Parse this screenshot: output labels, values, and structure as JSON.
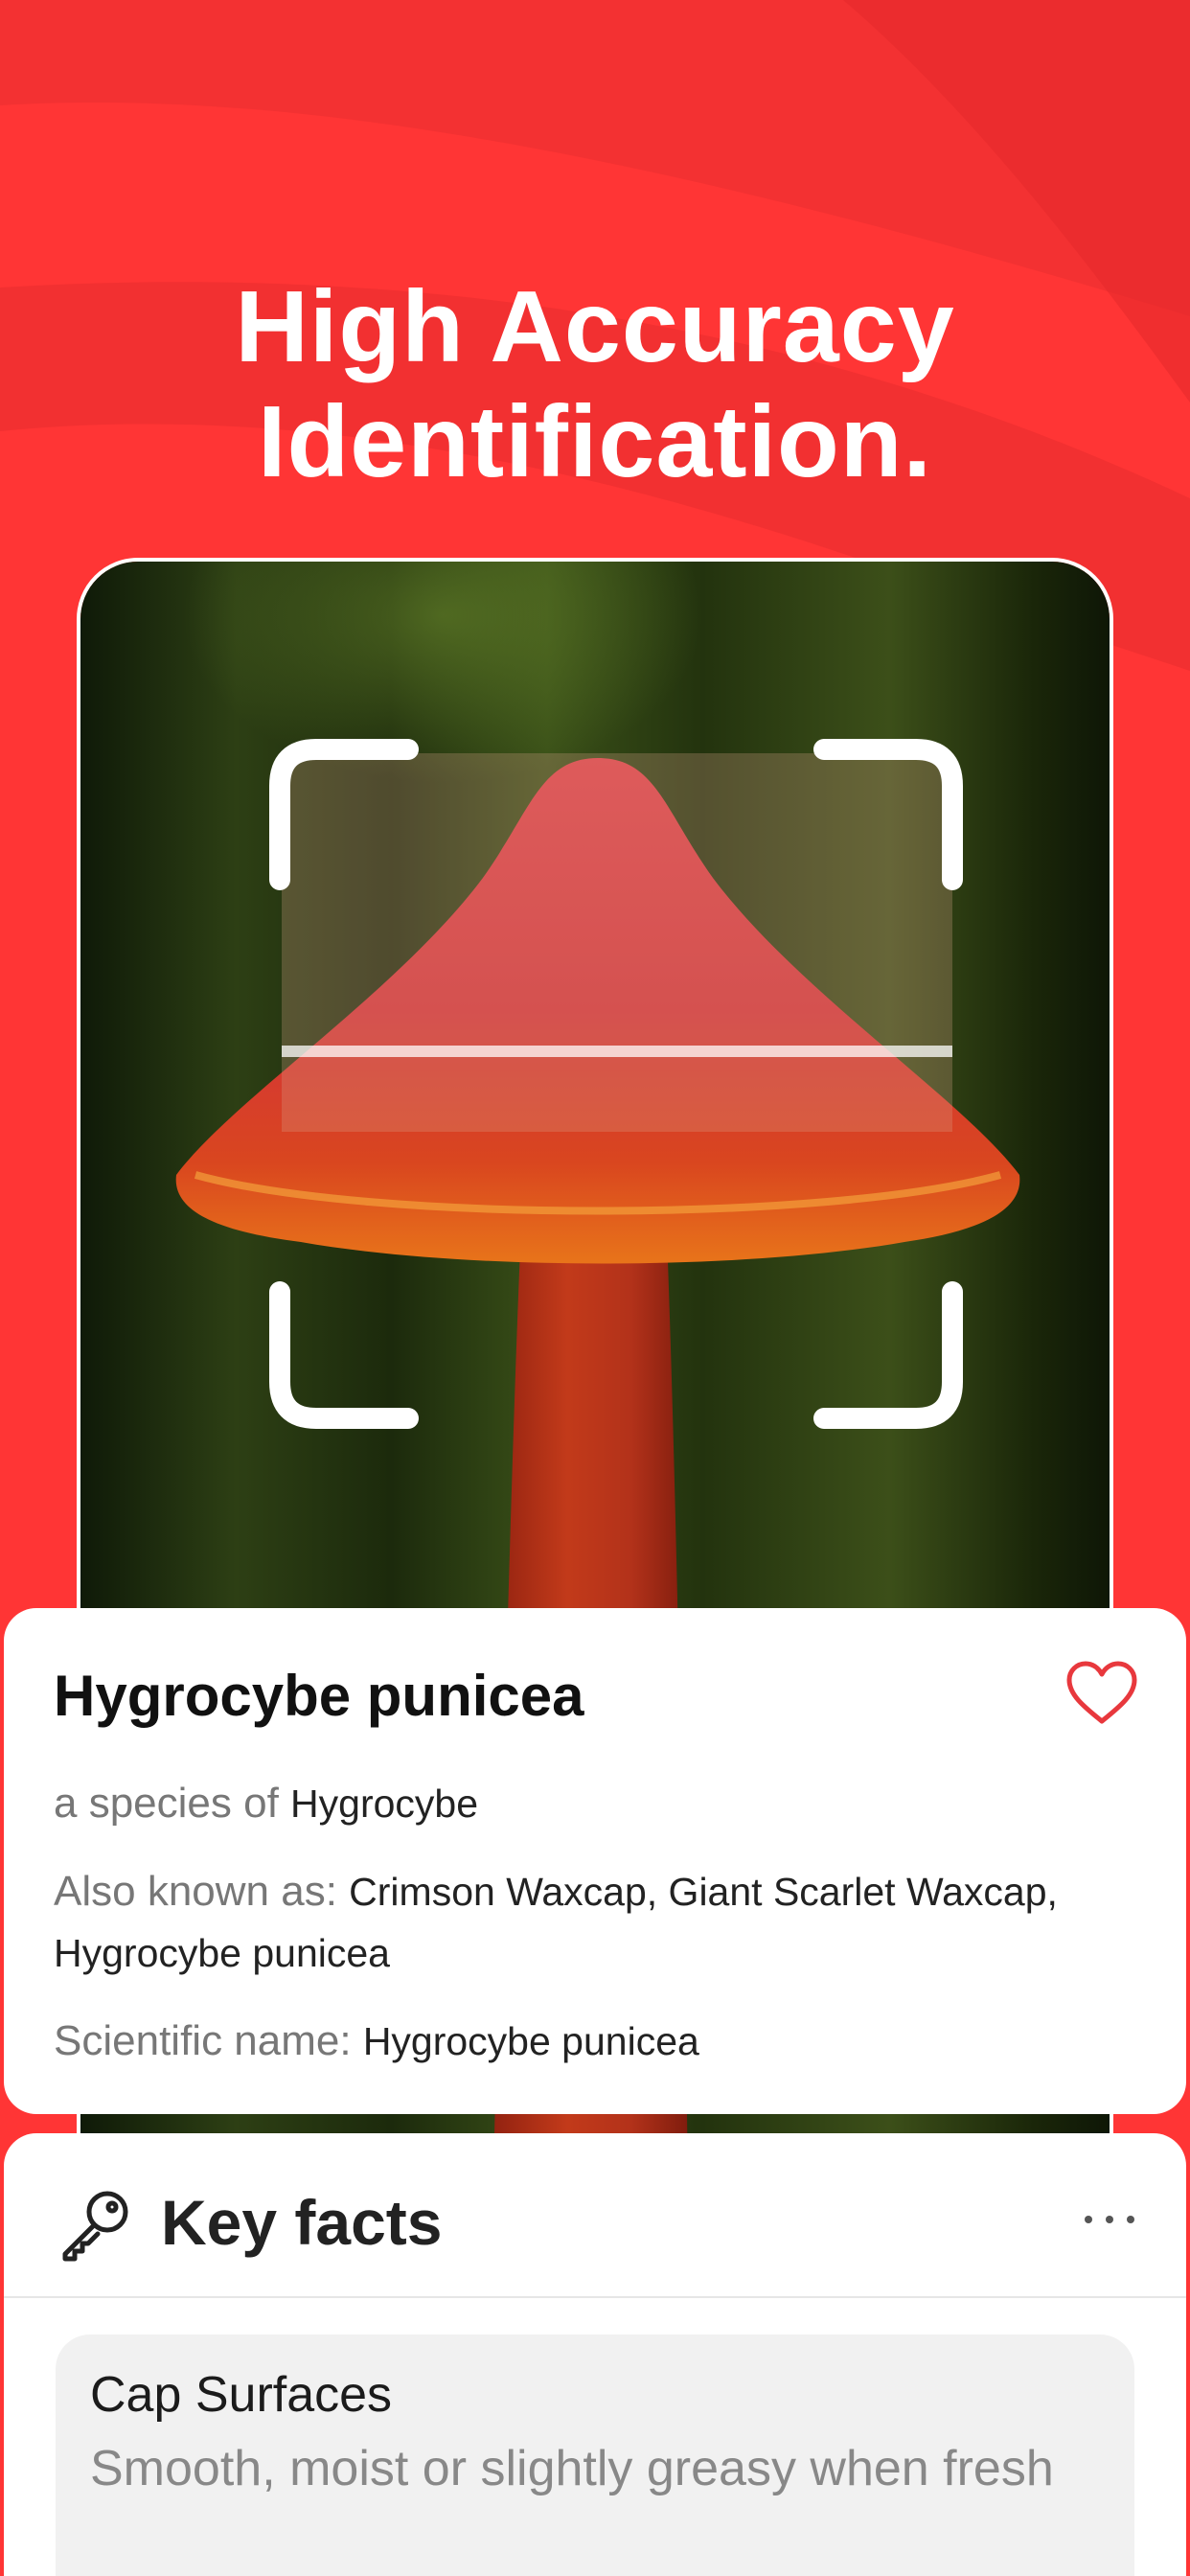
{
  "headline": {
    "line1": "High Accuracy",
    "line2": "Identification."
  },
  "colors": {
    "background": "#ff3535",
    "accent": "#e8383d",
    "card": "#ffffff"
  },
  "identification": {
    "name": "Hygrocybe punicea",
    "species_label": "a species of",
    "species_value": "Hygrocybe",
    "aka_label": "Also known as:",
    "aka_value": "Crimson Waxcap, Giant Scarlet Waxcap, Hygrocybe punicea",
    "sci_label": "Scientific name:",
    "sci_value": "Hygrocybe punicea",
    "favorite_icon": "heart-outline-icon"
  },
  "key_facts": {
    "icon": "key-icon",
    "title": "Key facts",
    "more_icon": "more-dots-icon",
    "items": [
      {
        "title": "Cap Surfaces",
        "text": "Smooth, moist or slightly greasy when fresh"
      }
    ]
  }
}
